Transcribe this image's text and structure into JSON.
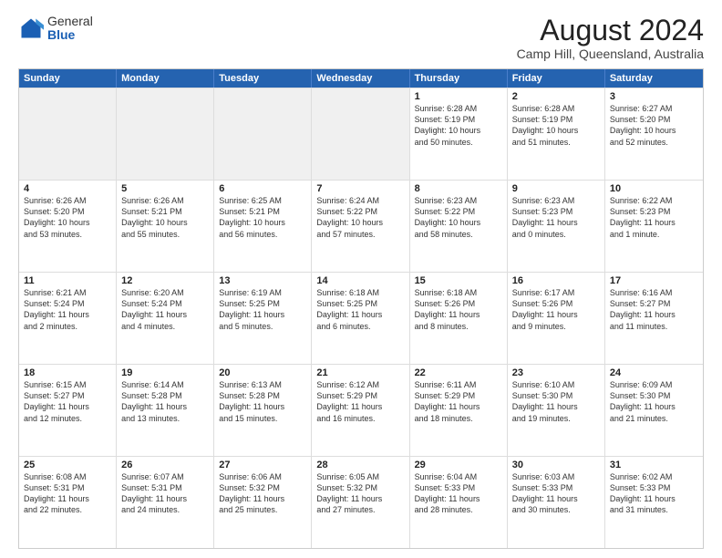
{
  "logo": {
    "general": "General",
    "blue": "Blue"
  },
  "title": "August 2024",
  "location": "Camp Hill, Queensland, Australia",
  "header_days": [
    "Sunday",
    "Monday",
    "Tuesday",
    "Wednesday",
    "Thursday",
    "Friday",
    "Saturday"
  ],
  "rows": [
    [
      {
        "day": "",
        "detail": ""
      },
      {
        "day": "",
        "detail": ""
      },
      {
        "day": "",
        "detail": ""
      },
      {
        "day": "",
        "detail": ""
      },
      {
        "day": "1",
        "detail": "Sunrise: 6:28 AM\nSunset: 5:19 PM\nDaylight: 10 hours\nand 50 minutes."
      },
      {
        "day": "2",
        "detail": "Sunrise: 6:28 AM\nSunset: 5:19 PM\nDaylight: 10 hours\nand 51 minutes."
      },
      {
        "day": "3",
        "detail": "Sunrise: 6:27 AM\nSunset: 5:20 PM\nDaylight: 10 hours\nand 52 minutes."
      }
    ],
    [
      {
        "day": "4",
        "detail": "Sunrise: 6:26 AM\nSunset: 5:20 PM\nDaylight: 10 hours\nand 53 minutes."
      },
      {
        "day": "5",
        "detail": "Sunrise: 6:26 AM\nSunset: 5:21 PM\nDaylight: 10 hours\nand 55 minutes."
      },
      {
        "day": "6",
        "detail": "Sunrise: 6:25 AM\nSunset: 5:21 PM\nDaylight: 10 hours\nand 56 minutes."
      },
      {
        "day": "7",
        "detail": "Sunrise: 6:24 AM\nSunset: 5:22 PM\nDaylight: 10 hours\nand 57 minutes."
      },
      {
        "day": "8",
        "detail": "Sunrise: 6:23 AM\nSunset: 5:22 PM\nDaylight: 10 hours\nand 58 minutes."
      },
      {
        "day": "9",
        "detail": "Sunrise: 6:23 AM\nSunset: 5:23 PM\nDaylight: 11 hours\nand 0 minutes."
      },
      {
        "day": "10",
        "detail": "Sunrise: 6:22 AM\nSunset: 5:23 PM\nDaylight: 11 hours\nand 1 minute."
      }
    ],
    [
      {
        "day": "11",
        "detail": "Sunrise: 6:21 AM\nSunset: 5:24 PM\nDaylight: 11 hours\nand 2 minutes."
      },
      {
        "day": "12",
        "detail": "Sunrise: 6:20 AM\nSunset: 5:24 PM\nDaylight: 11 hours\nand 4 minutes."
      },
      {
        "day": "13",
        "detail": "Sunrise: 6:19 AM\nSunset: 5:25 PM\nDaylight: 11 hours\nand 5 minutes."
      },
      {
        "day": "14",
        "detail": "Sunrise: 6:18 AM\nSunset: 5:25 PM\nDaylight: 11 hours\nand 6 minutes."
      },
      {
        "day": "15",
        "detail": "Sunrise: 6:18 AM\nSunset: 5:26 PM\nDaylight: 11 hours\nand 8 minutes."
      },
      {
        "day": "16",
        "detail": "Sunrise: 6:17 AM\nSunset: 5:26 PM\nDaylight: 11 hours\nand 9 minutes."
      },
      {
        "day": "17",
        "detail": "Sunrise: 6:16 AM\nSunset: 5:27 PM\nDaylight: 11 hours\nand 11 minutes."
      }
    ],
    [
      {
        "day": "18",
        "detail": "Sunrise: 6:15 AM\nSunset: 5:27 PM\nDaylight: 11 hours\nand 12 minutes."
      },
      {
        "day": "19",
        "detail": "Sunrise: 6:14 AM\nSunset: 5:28 PM\nDaylight: 11 hours\nand 13 minutes."
      },
      {
        "day": "20",
        "detail": "Sunrise: 6:13 AM\nSunset: 5:28 PM\nDaylight: 11 hours\nand 15 minutes."
      },
      {
        "day": "21",
        "detail": "Sunrise: 6:12 AM\nSunset: 5:29 PM\nDaylight: 11 hours\nand 16 minutes."
      },
      {
        "day": "22",
        "detail": "Sunrise: 6:11 AM\nSunset: 5:29 PM\nDaylight: 11 hours\nand 18 minutes."
      },
      {
        "day": "23",
        "detail": "Sunrise: 6:10 AM\nSunset: 5:30 PM\nDaylight: 11 hours\nand 19 minutes."
      },
      {
        "day": "24",
        "detail": "Sunrise: 6:09 AM\nSunset: 5:30 PM\nDaylight: 11 hours\nand 21 minutes."
      }
    ],
    [
      {
        "day": "25",
        "detail": "Sunrise: 6:08 AM\nSunset: 5:31 PM\nDaylight: 11 hours\nand 22 minutes."
      },
      {
        "day": "26",
        "detail": "Sunrise: 6:07 AM\nSunset: 5:31 PM\nDaylight: 11 hours\nand 24 minutes."
      },
      {
        "day": "27",
        "detail": "Sunrise: 6:06 AM\nSunset: 5:32 PM\nDaylight: 11 hours\nand 25 minutes."
      },
      {
        "day": "28",
        "detail": "Sunrise: 6:05 AM\nSunset: 5:32 PM\nDaylight: 11 hours\nand 27 minutes."
      },
      {
        "day": "29",
        "detail": "Sunrise: 6:04 AM\nSunset: 5:33 PM\nDaylight: 11 hours\nand 28 minutes."
      },
      {
        "day": "30",
        "detail": "Sunrise: 6:03 AM\nSunset: 5:33 PM\nDaylight: 11 hours\nand 30 minutes."
      },
      {
        "day": "31",
        "detail": "Sunrise: 6:02 AM\nSunset: 5:33 PM\nDaylight: 11 hours\nand 31 minutes."
      }
    ]
  ]
}
